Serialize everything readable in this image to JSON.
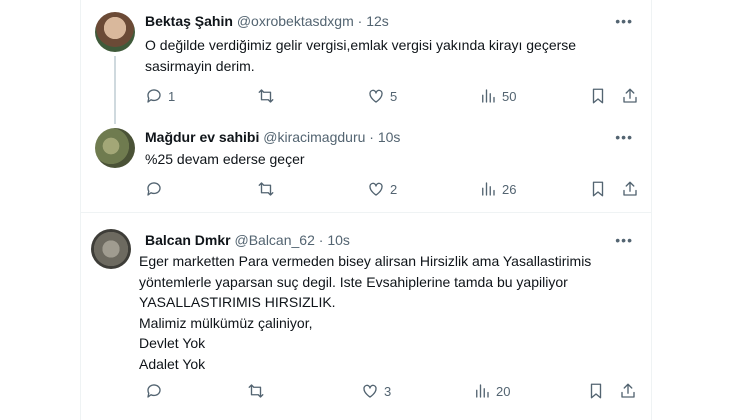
{
  "tweets": [
    {
      "name": "Bektaş Şahin",
      "handle": "@oxrobektasdxgm",
      "time": "12s",
      "text_lines": [
        "O değilde verdiğimiz gelir vergisi,emlak vergisi yakında kirayı geçerse",
        "sasirmayin derim."
      ],
      "replies": "1",
      "retweets": "",
      "likes": "5",
      "views": "50",
      "avatar_colors": [
        "#c9a58a",
        "#6b4a36"
      ]
    },
    {
      "name": "Mağdur ev sahibi",
      "handle": "@kiracimagduru",
      "time": "10s",
      "text_lines": [
        "%25 devam ederse geçer"
      ],
      "replies": "",
      "retweets": "",
      "likes": "2",
      "views": "26",
      "avatar_colors": [
        "#8a8f6a",
        "#4d5a3a"
      ]
    },
    {
      "name": "Balcan Dmkr",
      "handle": "@Balcan_62",
      "time": "10s",
      "text_lines": [
        "Eger marketten Para vermeden bisey alirsan Hirsizlik ama Yasallastirimis",
        "yöntemlerle yaparsan suç degil. Iste Evsahiplerine tamda bu yapiliyor",
        "YASALLASTIRIMIS HIRSIZLIK.",
        "Malimiz mülkümüz çaliniyor,",
        "Devlet Yok",
        "Adalet Yok"
      ],
      "replies": "",
      "retweets": "",
      "likes": "3",
      "views": "20",
      "avatar_colors": [
        "#7d7a70",
        "#3e3d38"
      ]
    }
  ],
  "icons": [
    "reply-icon",
    "retweet-icon",
    "like-icon",
    "views-icon",
    "bookmark-icon",
    "share-icon",
    "more-icon"
  ],
  "more_glyph": "•••",
  "dot": "·"
}
